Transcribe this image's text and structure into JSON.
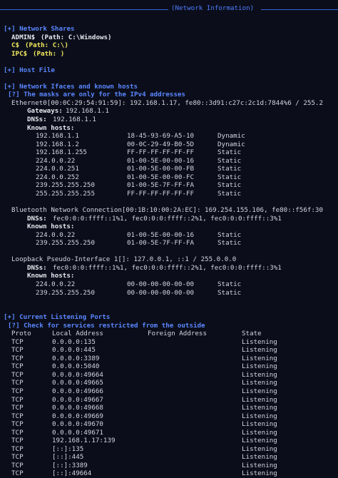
{
  "header": {
    "title": "(Network Information)"
  },
  "shares": {
    "heading": "[+] Network Shares",
    "items": [
      {
        "name": "ADMIN$",
        "path": "(Path: C:\\Windows)"
      },
      {
        "name": "C$",
        "path": "(Path: C:\\)"
      },
      {
        "name": "IPC$",
        "path": "(Path: )"
      }
    ]
  },
  "host_file": {
    "heading": "[+] Host File"
  },
  "ifaces": {
    "heading": "[+] Network Ifaces and known hosts",
    "note": "[?] The masks are only for the IPv4 addresses",
    "adapters": [
      {
        "line": "Ethernet0[00:0C:29:54:91:59]: 192.168.1.17, fe80::3d91:c27c:2c1d:7844%6 / 255.2",
        "fields": [
          {
            "label": "Gateways:",
            "value": "192.168.1.1"
          },
          {
            "label": "DNSs:",
            "value": "192.168.1.1"
          }
        ],
        "known_label": "Known hosts:",
        "hosts": [
          {
            "ip": "192.168.1.1",
            "mac": "18-45-93-69-A5-10",
            "type": "Dynamic"
          },
          {
            "ip": "192.168.1.2",
            "mac": "00-0C-29-49-B0-5D",
            "type": "Dynamic"
          },
          {
            "ip": "192.168.1.255",
            "mac": "FF-FF-FF-FF-FF-FF",
            "type": "Static"
          },
          {
            "ip": "224.0.0.22",
            "mac": "01-00-5E-00-00-16",
            "type": "Static"
          },
          {
            "ip": "224.0.0.251",
            "mac": "01-00-5E-00-00-FB",
            "type": "Static"
          },
          {
            "ip": "224.0.0.252",
            "mac": "01-00-5E-00-00-FC",
            "type": "Static"
          },
          {
            "ip": "239.255.255.250",
            "mac": "01-00-5E-7F-FF-FA",
            "type": "Static"
          },
          {
            "ip": "255.255.255.255",
            "mac": "FF-FF-FF-FF-FF-FF",
            "type": "Static"
          }
        ]
      },
      {
        "line": "Bluetooth Network Connection[00:1B:10:00:2A:EC]: 169.254.155.106, fe80::f56f:30",
        "fields": [
          {
            "label": "DNSs:",
            "value": "fec0:0:0:ffff::1%1, fec0:0:0:ffff::2%1, fec0:0:0:ffff::3%1"
          }
        ],
        "known_label": "Known hosts:",
        "hosts": [
          {
            "ip": "224.0.0.22",
            "mac": "01-00-5E-00-00-16",
            "type": "Static"
          },
          {
            "ip": "239.255.255.250",
            "mac": "01-00-5E-7F-FF-FA",
            "type": "Static"
          }
        ]
      },
      {
        "line": "Loopback Pseudo-Interface 1[]: 127.0.0.1, ::1 / 255.0.0.0",
        "fields": [
          {
            "label": "DNSs:",
            "value": "fec0:0:0:ffff::1%1, fec0:0:0:ffff::2%1, fec0:0:0:ffff::3%1"
          }
        ],
        "known_label": "Known hosts:",
        "hosts": [
          {
            "ip": "224.0.0.22",
            "mac": "00-00-00-00-00-00",
            "type": "Static"
          },
          {
            "ip": "239.255.255.250",
            "mac": "00-00-00-00-00-00",
            "type": "Static"
          }
        ]
      }
    ]
  },
  "ports": {
    "heading": "[+] Current Listening Ports",
    "note": "[?] Check for services restricted from the outside",
    "columns": [
      "Proto",
      "Local Address",
      "Foreign Address",
      "State"
    ],
    "rows": [
      {
        "proto": "TCP",
        "local": "0.0.0.0:135",
        "foreign": "",
        "state": "Listening"
      },
      {
        "proto": "TCP",
        "local": "0.0.0.0:445",
        "foreign": "",
        "state": "Listening"
      },
      {
        "proto": "TCP",
        "local": "0.0.0.0:3389",
        "foreign": "",
        "state": "Listening"
      },
      {
        "proto": "TCP",
        "local": "0.0.0.0:5040",
        "foreign": "",
        "state": "Listening"
      },
      {
        "proto": "TCP",
        "local": "0.0.0.0:49664",
        "foreign": "",
        "state": "Listening"
      },
      {
        "proto": "TCP",
        "local": "0.0.0.0:49665",
        "foreign": "",
        "state": "Listening"
      },
      {
        "proto": "TCP",
        "local": "0.0.0.0:49666",
        "foreign": "",
        "state": "Listening"
      },
      {
        "proto": "TCP",
        "local": "0.0.0.0:49667",
        "foreign": "",
        "state": "Listening"
      },
      {
        "proto": "TCP",
        "local": "0.0.0.0:49668",
        "foreign": "",
        "state": "Listening"
      },
      {
        "proto": "TCP",
        "local": "0.0.0.0:49669",
        "foreign": "",
        "state": "Listening"
      },
      {
        "proto": "TCP",
        "local": "0.0.0.0:49670",
        "foreign": "",
        "state": "Listening"
      },
      {
        "proto": "TCP",
        "local": "0.0.0.0:49671",
        "foreign": "",
        "state": "Listening"
      },
      {
        "proto": "TCP",
        "local": "192.168.1.17:139",
        "foreign": "",
        "state": "Listening"
      },
      {
        "proto": "TCP",
        "local": "[::]:135",
        "foreign": "",
        "state": "Listening"
      },
      {
        "proto": "TCP",
        "local": "[::]:445",
        "foreign": "",
        "state": "Listening"
      },
      {
        "proto": "TCP",
        "local": "[::]:3389",
        "foreign": "",
        "state": "Listening"
      },
      {
        "proto": "TCP",
        "local": "[::]:49664",
        "foreign": "",
        "state": "Listening"
      }
    ]
  },
  "colors": {
    "background": "#0b0e1a",
    "heading": "#5a86ff",
    "path": "#f2e860",
    "text": "#d3d6e0"
  }
}
